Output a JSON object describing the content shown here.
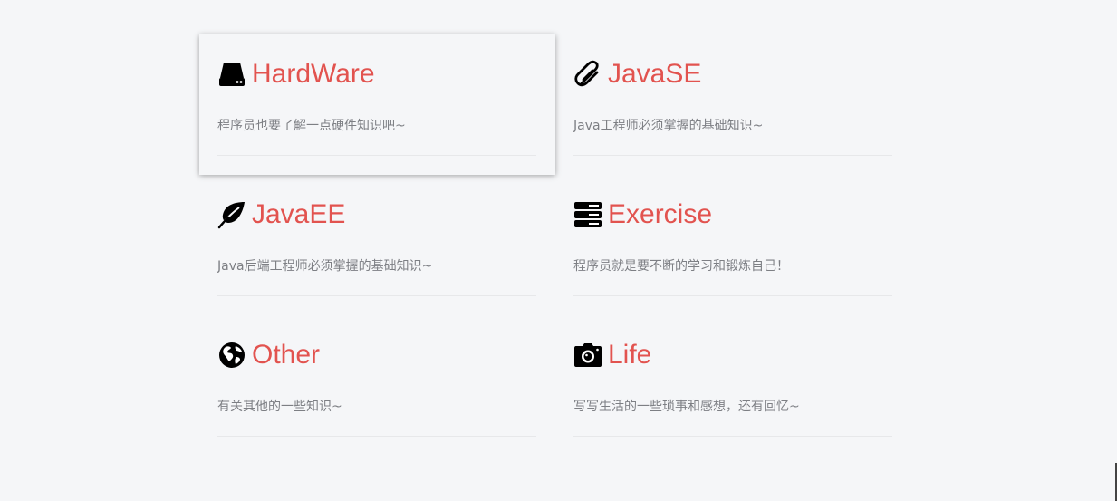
{
  "categories": [
    {
      "key": "hardware",
      "icon": "hard-drive-icon",
      "title": "HardWare",
      "desc": "程序员也要了解一点硬件知识吧~"
    },
    {
      "key": "javase",
      "icon": "paperclip-icon",
      "title": "JavaSE",
      "desc": "Java工程师必须掌握的基础知识~"
    },
    {
      "key": "javaee",
      "icon": "leaf-icon",
      "title": "JavaEE",
      "desc": "Java后端工程师必须掌握的基础知识~"
    },
    {
      "key": "exercise",
      "icon": "server-stack-icon",
      "title": "Exercise",
      "desc": "程序员就是要不断的学习和锻炼自己！"
    },
    {
      "key": "other",
      "icon": "globe-icon",
      "title": "Other",
      "desc": "有关其他的一些知识~"
    },
    {
      "key": "life",
      "icon": "camera-icon",
      "title": "Life",
      "desc": "写写生活的一些琐事和感想，还有回忆~"
    }
  ],
  "colors": {
    "background": "#f5f6f8",
    "title": "#e2534f",
    "description": "#7d7f84",
    "divider": "#e7e8ea"
  }
}
